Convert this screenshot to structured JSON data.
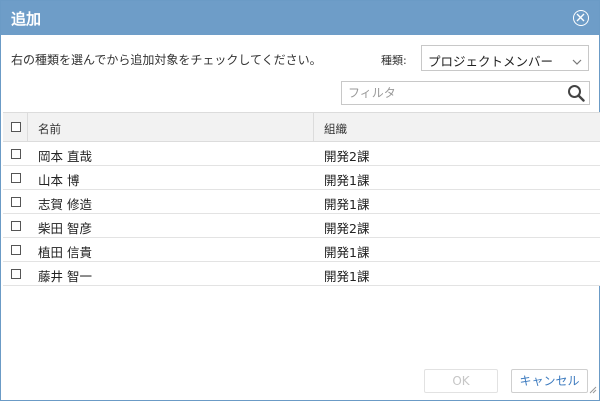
{
  "dialog": {
    "title": "追加",
    "instruction": "右の種類を選んでから追加対象をチェックしてください。",
    "type_label": "種類:",
    "type_value": "プロジェクトメンバー",
    "filter_placeholder": "フィルタ",
    "columns": {
      "name": "名前",
      "org": "組織"
    },
    "rows": [
      {
        "name": "岡本 直哉",
        "org": "開発2課"
      },
      {
        "name": "山本 博",
        "org": "開発1課"
      },
      {
        "name": "志賀 修造",
        "org": "開発1課"
      },
      {
        "name": "柴田 智彦",
        "org": "開発2課"
      },
      {
        "name": "植田 信貴",
        "org": "開発1課"
      },
      {
        "name": "藤井 智一",
        "org": "開発1課"
      }
    ],
    "ok_label": "OK",
    "cancel_label": "キャンセル",
    "accent_color": "#6e9dc8"
  }
}
